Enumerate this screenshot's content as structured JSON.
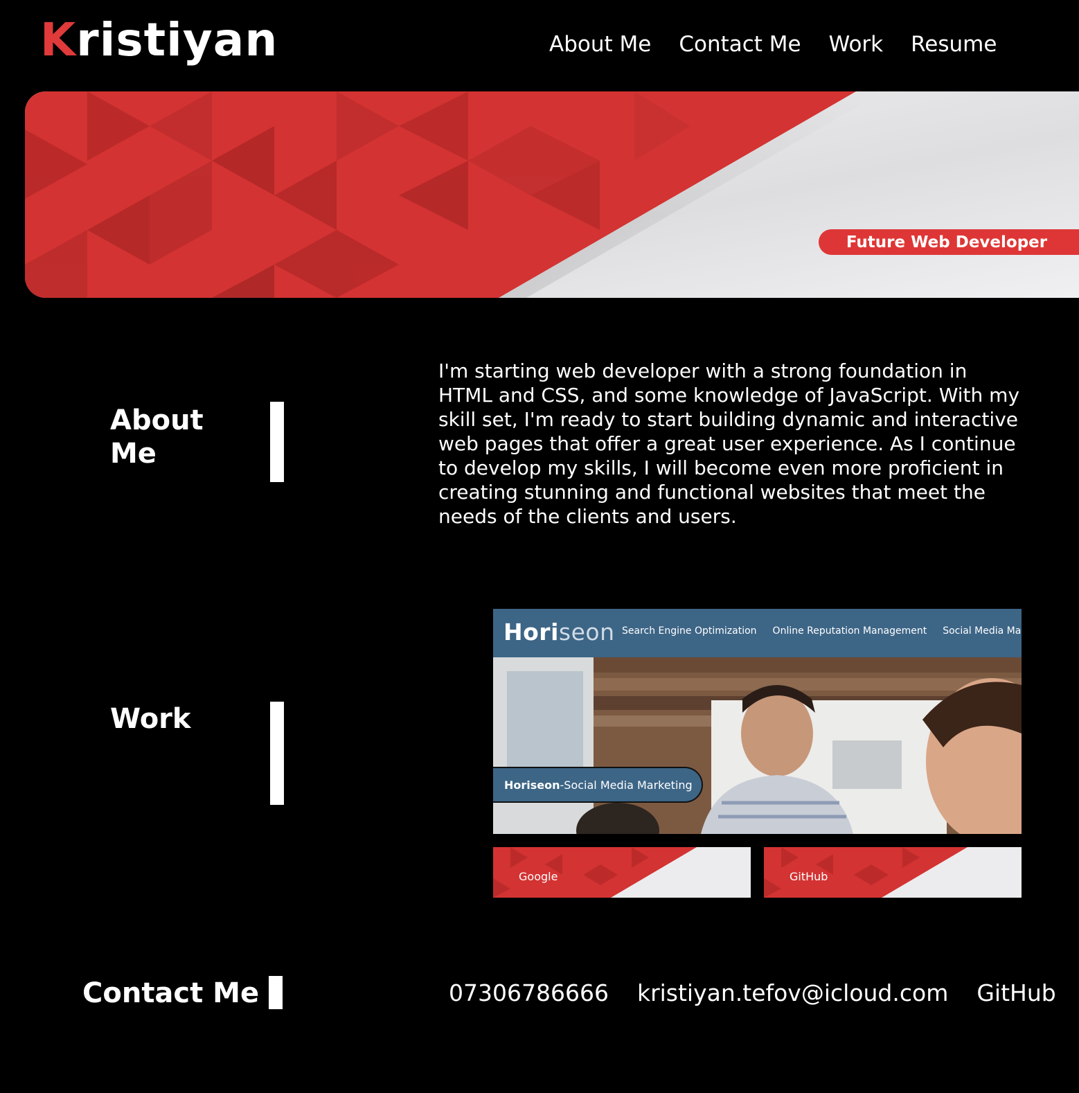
{
  "header": {
    "logo_first": "K",
    "logo_rest": "ristiyan",
    "nav": [
      "About Me",
      "Contact Me",
      "Work",
      "Resume"
    ]
  },
  "hero": {
    "badge": "Future Web Developer"
  },
  "about": {
    "title": "About Me",
    "text": "I'm starting web developer with a strong foundation in HTML and CSS, and some knowledge of JavaScript. With my skill set, I'm ready to start building dynamic and interactive web pages that offer a great user experience. As I continue to develop my skills, I will become even more proficient in creating stunning and functional websites that meet the needs of the clients and users."
  },
  "work": {
    "title": "Work",
    "project": {
      "brand_a": "Hori",
      "brand_b": "seon",
      "nav": [
        "Search Engine Optimization",
        "Online Reputation Management",
        "Social Media Marketing"
      ],
      "label_bold": "Horiseon",
      "label_rest": "-Social Media Marketing"
    },
    "links": [
      "Google",
      "GitHub"
    ]
  },
  "contact": {
    "title": "Contact Me",
    "phone": "07306786666",
    "email": "kristiyan.tefov@icloud.com",
    "github": "GitHub"
  },
  "colors": {
    "accent": "#de3636",
    "background": "#000000",
    "project_blue": "#3d6586"
  },
  "icons": []
}
